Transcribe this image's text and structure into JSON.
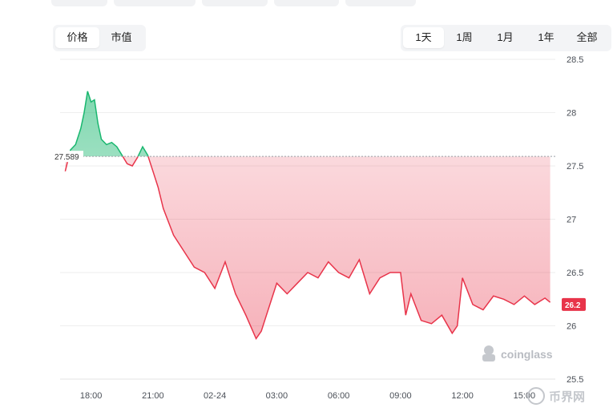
{
  "metric_tabs": [
    {
      "label": "价格",
      "active": true
    },
    {
      "label": "市值",
      "active": false
    }
  ],
  "range_tabs": [
    {
      "label": "1天",
      "active": true
    },
    {
      "label": "1周",
      "active": false
    },
    {
      "label": "1月",
      "active": false
    },
    {
      "label": "1年",
      "active": false
    },
    {
      "label": "全部",
      "active": false
    }
  ],
  "watermark": "coinglass",
  "site_watermark": "币界网",
  "colors": {
    "up": "#19b76f",
    "down": "#e8344a",
    "reference": "#9aa0a6",
    "grid": "#eeeeee"
  },
  "chart_data": {
    "type": "area",
    "title": "",
    "xlabel": "",
    "ylabel": "",
    "ylim": [
      25.5,
      28.5
    ],
    "yticks": [
      25.5,
      26,
      26.5,
      27,
      27.5,
      28,
      28.5
    ],
    "ytick_labels": [
      "25.5",
      "26",
      "26.5",
      "27",
      "27.5",
      "28",
      "28.5"
    ],
    "x_range": [
      "02-23 16:30",
      "02-24 16:30"
    ],
    "xticks": [
      {
        "at": "02-23 18:00",
        "label": "18:00"
      },
      {
        "at": "02-23 21:00",
        "label": "21:00"
      },
      {
        "at": "02-24 00:00",
        "label": "02-24"
      },
      {
        "at": "02-24 03:00",
        "label": "03:00"
      },
      {
        "at": "02-24 06:00",
        "label": "06:00"
      },
      {
        "at": "02-24 09:00",
        "label": "09:00"
      },
      {
        "at": "02-24 12:00",
        "label": "12:00"
      },
      {
        "at": "02-24 15:00",
        "label": "15:00"
      }
    ],
    "reference_price": 27.589,
    "reference_label": "27.589",
    "current_price": 26.2,
    "current_label": "26.2",
    "grid": true,
    "series": [
      {
        "x": [
          "02-23 16:45",
          "02-23 17:00",
          "02-23 17:15",
          "02-23 17:30",
          "02-23 17:40",
          "02-23 17:50",
          "02-23 18:00",
          "02-23 18:10",
          "02-23 18:20",
          "02-23 18:30",
          "02-23 18:45",
          "02-23 19:00",
          "02-23 19:15",
          "02-23 19:30",
          "02-23 19:45",
          "02-23 20:00",
          "02-23 20:15",
          "02-23 20:30",
          "02-23 20:45",
          "02-23 21:00",
          "02-23 21:15",
          "02-23 21:30",
          "02-23 22:00",
          "02-23 22:30",
          "02-23 23:00",
          "02-23 23:30",
          "02-24 00:00",
          "02-24 00:30",
          "02-24 00:45",
          "02-24 01:00",
          "02-24 01:30",
          "02-24 02:00",
          "02-24 02:15",
          "02-24 02:30",
          "02-24 03:00",
          "02-24 03:30",
          "02-24 04:00",
          "02-24 04:30",
          "02-24 05:00",
          "02-24 05:30",
          "02-24 06:00",
          "02-24 06:30",
          "02-24 07:00",
          "02-24 07:30",
          "02-24 08:00",
          "02-24 08:30",
          "02-24 09:00",
          "02-24 09:15",
          "02-24 09:30",
          "02-24 10:00",
          "02-24 10:30",
          "02-24 11:00",
          "02-24 11:30",
          "02-24 11:45",
          "02-24 12:00",
          "02-24 12:30",
          "02-24 13:00",
          "02-24 13:30",
          "02-24 14:00",
          "02-24 14:30",
          "02-24 15:00",
          "02-24 15:30",
          "02-24 16:00",
          "02-24 16:15"
        ],
        "values": [
          27.45,
          27.65,
          27.7,
          27.85,
          28.0,
          28.2,
          28.1,
          28.12,
          27.9,
          27.75,
          27.7,
          27.72,
          27.68,
          27.6,
          27.52,
          27.5,
          27.58,
          27.68,
          27.6,
          27.45,
          27.3,
          27.1,
          26.85,
          26.7,
          26.55,
          26.5,
          26.35,
          26.6,
          26.45,
          26.3,
          26.1,
          25.88,
          25.95,
          26.1,
          26.4,
          26.3,
          26.4,
          26.5,
          26.45,
          26.6,
          26.5,
          26.45,
          26.62,
          26.3,
          26.45,
          26.5,
          26.5,
          26.1,
          26.3,
          26.05,
          26.02,
          26.1,
          25.93,
          26.0,
          26.45,
          26.2,
          26.15,
          26.28,
          26.25,
          26.2,
          26.28,
          26.2,
          26.26,
          26.22
        ],
        "color_above_reference": "#19b76f",
        "color_below_reference": "#e8344a"
      }
    ]
  }
}
